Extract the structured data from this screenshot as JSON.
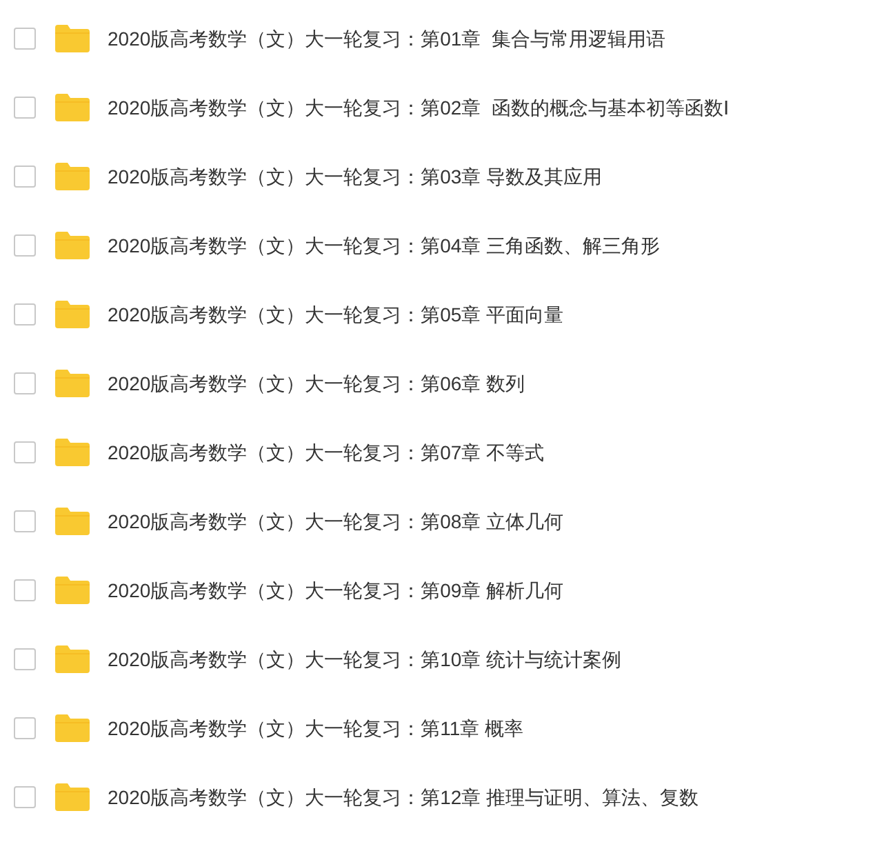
{
  "items": [
    {
      "name": "2020版高考数学（文）大一轮复习：第01章  集合与常用逻辑用语",
      "checked": false
    },
    {
      "name": "2020版高考数学（文）大一轮复习：第02章  函数的概念与基本初等函数Ⅰ",
      "checked": false
    },
    {
      "name": "2020版高考数学（文）大一轮复习：第03章 导数及其应用",
      "checked": false
    },
    {
      "name": "2020版高考数学（文）大一轮复习：第04章 三角函数、解三角形",
      "checked": false
    },
    {
      "name": "2020版高考数学（文）大一轮复习：第05章 平面向量",
      "checked": false
    },
    {
      "name": "2020版高考数学（文）大一轮复习：第06章 数列",
      "checked": false
    },
    {
      "name": "2020版高考数学（文）大一轮复习：第07章 不等式",
      "checked": false
    },
    {
      "name": "2020版高考数学（文）大一轮复习：第08章 立体几何",
      "checked": false
    },
    {
      "name": "2020版高考数学（文）大一轮复习：第09章 解析几何",
      "checked": false
    },
    {
      "name": "2020版高考数学（文）大一轮复习：第10章 统计与统计案例",
      "checked": false
    },
    {
      "name": "2020版高考数学（文）大一轮复习：第11章 概率",
      "checked": false
    },
    {
      "name": "2020版高考数学（文）大一轮复习：第12章 推理与证明、算法、复数",
      "checked": false
    }
  ]
}
